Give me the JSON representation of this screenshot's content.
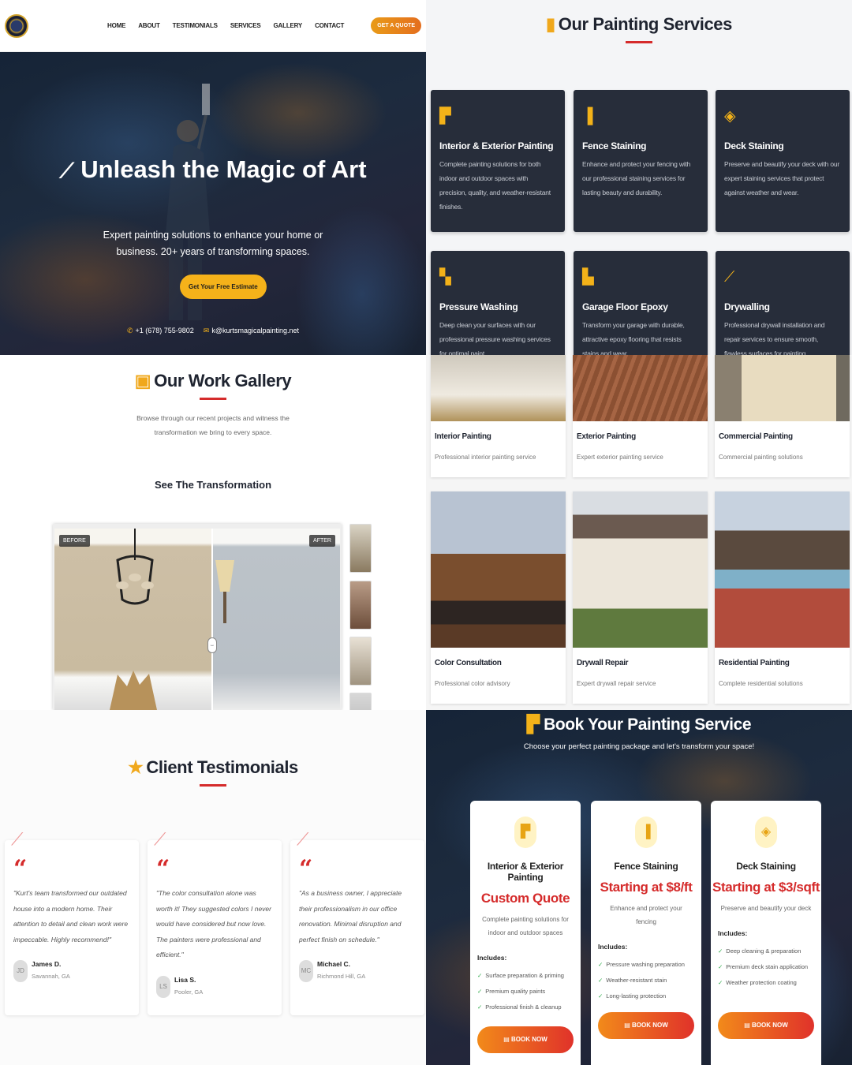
{
  "nav": {
    "links": [
      "HOME",
      "ABOUT",
      "TESTIMONIALS",
      "SERVICES",
      "GALLERY",
      "CONTACT"
    ],
    "quote_button": "GET A QUOTE"
  },
  "hero": {
    "title": "Unleash the Magic of Art",
    "subtitle": "Expert painting solutions to enhance your home or business. 20+ years of transforming spaces.",
    "cta": "Get Your Free Estimate",
    "phone": "+1 (678) 755-9802",
    "email": "k@kurtsmagicalpainting.net"
  },
  "services": {
    "title": "Our Painting Services",
    "items": [
      {
        "icon": "paint-roller-icon",
        "title": "Interior & Exterior Painting",
        "desc": "Complete painting solutions for both indoor and outdoor spaces with precision, quality, and weather-resistant finishes."
      },
      {
        "icon": "brush-icon",
        "title": "Fence Staining",
        "desc": "Enhance and protect your fencing with our professional staining services for lasting beauty and durability."
      },
      {
        "icon": "layers-icon",
        "title": "Deck Staining",
        "desc": "Preserve and beautify your deck with our expert staining services that protect against weather and wear."
      },
      {
        "icon": "spray-bottle-icon",
        "title": "Pressure Washing",
        "desc": "Deep clean your surfaces with our professional pressure washing services for optimal paint"
      },
      {
        "icon": "car-icon",
        "title": "Garage Floor Epoxy",
        "desc": "Transform your garage with durable, attractive epoxy flooring that resists stains and wear."
      },
      {
        "icon": "hammer-icon",
        "title": "Drywalling",
        "desc": "Professional drywall installation and repair services to ensure smooth, flawless surfaces for painting."
      }
    ]
  },
  "gallery": {
    "title": "Our Work Gallery",
    "subtitle": "Browse through our recent projects and witness the transformation we bring to every space.",
    "transformation_title": "See The Transformation",
    "before_label": "BEFORE",
    "after_label": "AFTER",
    "cards": [
      {
        "title": "Interior Painting",
        "desc": "Professional interior painting service"
      },
      {
        "title": "Exterior Painting",
        "desc": "Expert exterior painting service"
      },
      {
        "title": "Commercial Painting",
        "desc": "Commercial painting solutions"
      },
      {
        "title": "Color Consultation",
        "desc": "Professional color advisory"
      },
      {
        "title": "Drywall Repair",
        "desc": "Expert drywall repair service"
      },
      {
        "title": "Residential Painting",
        "desc": "Complete residential solutions"
      }
    ]
  },
  "testimonials": {
    "title": "Client Testimonials",
    "items": [
      {
        "quote": "\"Kurt's team transformed our outdated house into a modern home. Their attention to detail and clean work were impeccable. Highly recommend!\"",
        "initials": "JD",
        "name": "James D.",
        "location": "Savannah, GA"
      },
      {
        "quote": "\"The color consultation alone was worth it! They suggested colors I never would have considered but now love. The painters were professional and efficient.\"",
        "initials": "LS",
        "name": "Lisa S.",
        "location": "Pooler, GA"
      },
      {
        "quote": "\"As a business owner, I appreciate their professionalism in our office renovation. Minimal disruption and perfect finish on schedule.\"",
        "initials": "MC",
        "name": "Michael C.",
        "location": "Richmond Hill, GA"
      }
    ]
  },
  "booking": {
    "title": "Book Your Painting Service",
    "subtitle": "Choose your perfect painting package and let's transform your space!",
    "includes_label": "Includes:",
    "button": "BOOK NOW",
    "packages": [
      {
        "icon": "paint-roller-icon",
        "title": "Interior & Exterior Painting",
        "price": "Custom Quote",
        "desc": "Complete painting solutions for indoor and outdoor spaces",
        "features": [
          "Surface preparation & priming",
          "Premium quality paints",
          "Professional finish & cleanup"
        ]
      },
      {
        "icon": "brush-icon",
        "title": "Fence Staining",
        "price": "Starting at $8/ft",
        "desc": "Enhance and protect your fencing",
        "features": [
          "Pressure washing preparation",
          "Weather-resistant stain",
          "Long-lasting protection"
        ]
      },
      {
        "icon": "layers-icon",
        "title": "Deck Staining",
        "price": "Starting at $3/sqft",
        "desc": "Preserve and beautify your deck",
        "features": [
          "Deep cleaning & preparation",
          "Premium deck stain application",
          "Weather protection coating"
        ]
      }
    ]
  },
  "colors": {
    "accent": "#f3b219",
    "red": "#d52b2b",
    "dark_card": "#272d3a"
  }
}
